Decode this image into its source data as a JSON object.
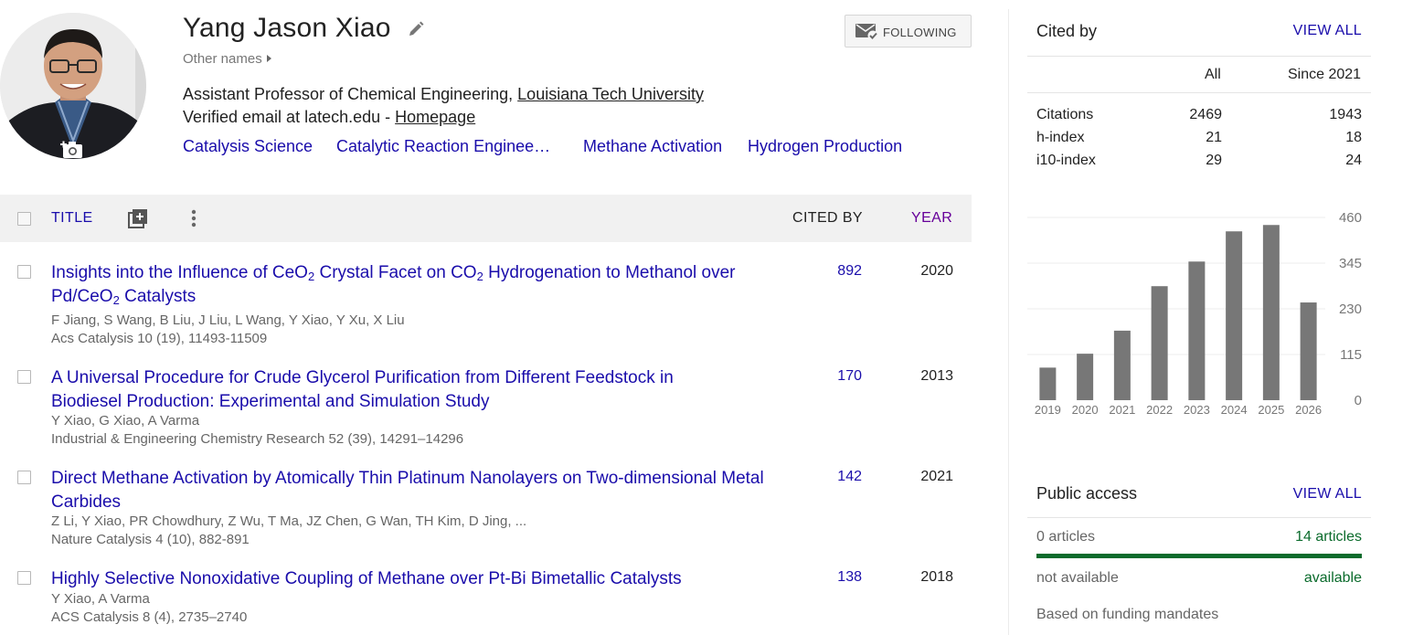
{
  "profile": {
    "name": "Yang Jason Xiao",
    "other_names": "Other names",
    "affiliation_prefix": "Assistant Professor of Chemical Engineering, ",
    "affiliation_link": "Louisiana Tech University",
    "email_prefix": "Verified email at latech.edu - ",
    "homepage": "Homepage",
    "interests": [
      "Catalysis Science",
      "Catalytic Reaction Enginee…",
      "Methane Activation",
      "Hydrogen Production"
    ],
    "follow_label": "FOLLOWING"
  },
  "table": {
    "title_header": "TITLE",
    "cited_header": "CITED BY",
    "year_header": "YEAR",
    "articles": [
      {
        "title_parts": [
          "Insights into the Influence of CeO",
          "2",
          " Crystal Facet on CO",
          "2",
          " Hydrogenation to Methanol over Pd/CeO",
          "2",
          " Catalysts"
        ],
        "authors": "F Jiang, S Wang, B Liu, J Liu, L Wang, Y Xiao, Y Xu, X Liu",
        "venue": "Acs Catalysis 10 (19), 11493-11509",
        "cited": "892",
        "year": "2020"
      },
      {
        "title": "A Universal Procedure for Crude Glycerol Purification from Different Feedstock in Biodiesel Production: Experimental and Simulation Study",
        "authors": "Y Xiao, G Xiao, A Varma",
        "venue": "Industrial & Engineering Chemistry Research 52 (39), 14291–14296",
        "cited": "170",
        "year": "2013"
      },
      {
        "title": "Direct Methane Activation by Atomically Thin Platinum Nanolayers on Two-dimensional Metal Carbides",
        "authors": "Z Li, Y Xiao, PR Chowdhury, Z Wu, T Ma, JZ Chen, G Wan, TH Kim, D Jing, ...",
        "venue": "Nature Catalysis 4 (10), 882-891",
        "cited": "142",
        "year": "2021"
      },
      {
        "title": "Highly Selective Nonoxidative Coupling of Methane over Pt-Bi Bimetallic Catalysts",
        "authors": "Y Xiao, A Varma",
        "venue": "ACS Catalysis 8 (4), 2735–2740",
        "cited": "138",
        "year": "2018"
      }
    ]
  },
  "cited_by": {
    "title": "Cited by",
    "view_all": "VIEW ALL",
    "col_all": "All",
    "col_since": "Since 2021",
    "rows": [
      {
        "label": "Citations",
        "all": "2469",
        "since": "1943"
      },
      {
        "label": "h-index",
        "all": "21",
        "since": "18"
      },
      {
        "label": "i10-index",
        "all": "29",
        "since": "24"
      }
    ]
  },
  "chart_data": {
    "type": "bar",
    "categories": [
      "2019",
      "2020",
      "2021",
      "2022",
      "2023",
      "2024",
      "2025",
      "2026"
    ],
    "values": [
      82,
      117,
      175,
      287,
      349,
      425,
      441,
      246
    ],
    "yticks": [
      0,
      115,
      230,
      345,
      460
    ],
    "ylim": [
      0,
      460
    ],
    "bar_color": "#777777"
  },
  "public_access": {
    "title": "Public access",
    "view_all": "VIEW ALL",
    "not_available_count": "0 articles",
    "available_count": "14 articles",
    "not_available_label": "not available",
    "available_label": "available",
    "note": "Based on funding mandates",
    "available_color": "#0b6b2c"
  }
}
